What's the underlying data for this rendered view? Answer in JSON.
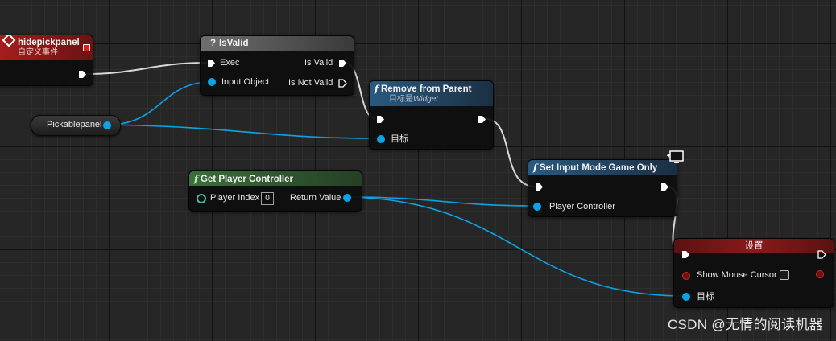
{
  "event_node": {
    "title": "hidepickpanel",
    "subtitle": "自定义事件",
    "color": "#8c1a1a"
  },
  "isvalid_node": {
    "title": "IsValid",
    "glyph": "?",
    "pins": {
      "exec": "Exec",
      "input_object": "Input Object",
      "is_valid": "Is Valid",
      "is_not_valid": "Is Not Valid"
    }
  },
  "variable_node": {
    "label": "Pickablepanel"
  },
  "remove_node": {
    "title": "Remove from Parent",
    "subtitle_prefix": "目标是",
    "subtitle_target": "Widget",
    "target_label": "目标"
  },
  "getpc_node": {
    "title": "Get Player Controller",
    "pins": {
      "player_index": "Player Index",
      "player_index_value": "0",
      "return_value": "Return Value"
    }
  },
  "setinput_node": {
    "title": "Set Input Mode Game Only",
    "pins": {
      "player_controller": "Player Controller"
    }
  },
  "set_node": {
    "title": "设置",
    "pins": {
      "show_mouse_cursor": "Show Mouse Cursor",
      "target": "目标"
    }
  },
  "watermark": "CSDN @无情的阅读机器",
  "colors": {
    "object_pin": "#0aa3e8",
    "function_header": "#1f3a52",
    "pure_function_header": "#2c4a2c",
    "event_header": "#8c1a1a",
    "macro_header": "#5a5a5a",
    "exec_wire": "#e6e6e6"
  }
}
